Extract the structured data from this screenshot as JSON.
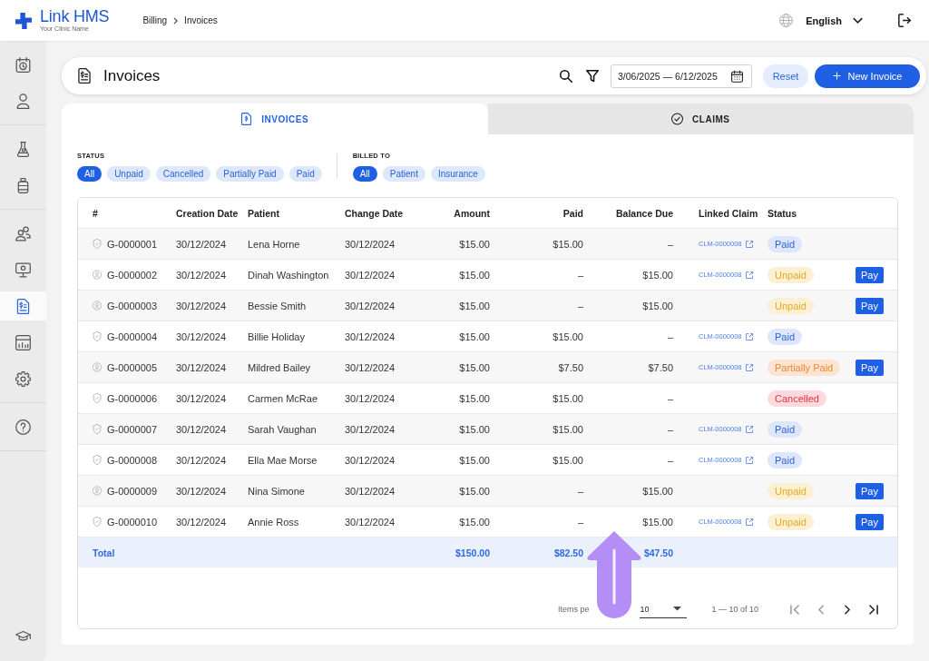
{
  "top_bar": {
    "app_name": "Link HMS",
    "clinic_name": "Your Clinic Name",
    "breadcrumb": [
      "Billing",
      "Invoices"
    ],
    "language": "English"
  },
  "sidebar": {
    "groups": [
      {
        "items": [
          {
            "kind": "calendar",
            "selected": false
          },
          {
            "kind": "person",
            "selected": false
          }
        ]
      },
      {
        "items": [
          {
            "kind": "flask",
            "selected": false
          },
          {
            "kind": "bottle",
            "selected": false
          }
        ]
      },
      {
        "items": [
          {
            "kind": "people",
            "selected": false
          },
          {
            "kind": "monitor",
            "selected": false
          },
          {
            "kind": "invoice",
            "selected": true
          },
          {
            "kind": "chart",
            "selected": false
          },
          {
            "kind": "gear",
            "selected": false
          }
        ]
      },
      {
        "items": [
          {
            "kind": "help",
            "selected": false
          }
        ]
      }
    ],
    "bottom_items": [
      {
        "kind": "cap",
        "selected": false
      }
    ]
  },
  "page_header": {
    "title": "Invoices",
    "date_range": "3/06/2025 — 6/12/2025",
    "buttons": [
      {
        "label": "Reset",
        "kind": "secondary"
      },
      {
        "label": "New Invoice",
        "kind": "primary"
      }
    ]
  },
  "tabs": [
    {
      "label": "INVOICES",
      "kind": "invoice",
      "selected": true
    },
    {
      "label": "CLAIMS",
      "kind": "check",
      "selected": false
    }
  ],
  "filters": [
    {
      "label": "STATUS",
      "chips": [
        {
          "label": "All",
          "selected": true
        },
        {
          "label": "Unpaid",
          "selected": false
        },
        {
          "label": "Cancelled",
          "selected": false
        },
        {
          "label": "Partially Paid",
          "selected": false
        },
        {
          "label": "Paid",
          "selected": false
        }
      ]
    },
    {
      "label": "BILLED TO",
      "chips": [
        {
          "label": "All",
          "selected": true
        },
        {
          "label": "Patient",
          "selected": false
        },
        {
          "label": "Insurance",
          "selected": false
        }
      ]
    }
  ],
  "table": {
    "columns": [
      "#",
      "Creation Date",
      "Patient",
      "Change Date",
      "Amount",
      "Paid",
      "Balance Due",
      "Linked Claim",
      "Status"
    ],
    "rows": [
      {
        "kind": "insurance",
        "number": "G-0000001",
        "creation_date": "30/12/2024",
        "patient": "Lena Horne",
        "change_date": "30/12/2024",
        "amount": "$15.00",
        "paid": "$15.00",
        "balance_due": "–",
        "linked_claim": "CLM-0000008",
        "status": {
          "label": "Paid",
          "kind": "paid"
        }
      },
      {
        "kind": "patient",
        "number": "G-0000002",
        "creation_date": "30/12/2024",
        "patient": "Dinah Washington",
        "change_date": "30/12/2024",
        "amount": "$15.00",
        "paid": "–",
        "balance_due": "$15.00",
        "linked_claim": "CLM-0000008",
        "status": {
          "label": "Unpaid",
          "kind": "unpaid"
        },
        "action": "Pay"
      },
      {
        "kind": "patient",
        "number": "G-0000003",
        "creation_date": "30/12/2024",
        "patient": "Bessie Smith",
        "change_date": "30/12/2024",
        "amount": "$15.00",
        "paid": "–",
        "balance_due": "$15.00",
        "status": {
          "label": "Unpaid",
          "kind": "unpaid"
        },
        "action": "Pay"
      },
      {
        "kind": "insurance",
        "number": "G-0000004",
        "creation_date": "30/12/2024",
        "patient": "Billie Holiday",
        "change_date": "30/12/2024",
        "amount": "$15.00",
        "paid": "$15.00",
        "balance_due": "–",
        "linked_claim": "CLM-0000008",
        "status": {
          "label": "Paid",
          "kind": "paid"
        }
      },
      {
        "kind": "patient",
        "number": "G-0000005",
        "creation_date": "30/12/2024",
        "patient": "Mildred Bailey",
        "change_date": "30/12/2024",
        "amount": "$15.00",
        "paid": "$7.50",
        "balance_due": "$7.50",
        "linked_claim": "CLM-0000008",
        "status": {
          "label": "Partially Paid",
          "kind": "partial"
        },
        "action": "Pay"
      },
      {
        "kind": "insurance",
        "number": "G-0000006",
        "creation_date": "30/12/2024",
        "patient": "Carmen McRae",
        "change_date": "30/12/2024",
        "amount": "$15.00",
        "paid": "$15.00",
        "balance_due": "–",
        "status": {
          "label": "Cancelled",
          "kind": "cancelled"
        }
      },
      {
        "kind": "insurance",
        "number": "G-0000007",
        "creation_date": "30/12/2024",
        "patient": "Sarah Vaughan",
        "change_date": "30/12/2024",
        "amount": "$15.00",
        "paid": "$15.00",
        "balance_due": "–",
        "linked_claim": "CLM-0000008",
        "status": {
          "label": "Paid",
          "kind": "paid"
        }
      },
      {
        "kind": "insurance",
        "number": "G-0000008",
        "creation_date": "30/12/2024",
        "patient": "Ella Mae Morse",
        "change_date": "30/12/2024",
        "amount": "$15.00",
        "paid": "$15.00",
        "balance_due": "–",
        "linked_claim": "CLM-0000008",
        "status": {
          "label": "Paid",
          "kind": "paid"
        }
      },
      {
        "kind": "patient",
        "number": "G-0000009",
        "creation_date": "30/12/2024",
        "patient": "Nina Simone",
        "change_date": "30/12/2024",
        "amount": "$15.00",
        "paid": "–",
        "balance_due": "$15.00",
        "status": {
          "label": "Unpaid",
          "kind": "unpaid"
        },
        "action": "Pay"
      },
      {
        "kind": "insurance",
        "number": "G-0000010",
        "creation_date": "30/12/2024",
        "patient": "Annie Ross",
        "change_date": "30/12/2024",
        "amount": "$15.00",
        "paid": "–",
        "balance_due": "$15.00",
        "linked_claim": "CLM-0000008",
        "status": {
          "label": "Unpaid",
          "kind": "unpaid"
        },
        "action": "Pay"
      }
    ],
    "total": {
      "label": "Total",
      "amount": "$150.00",
      "paid": "$82.50",
      "balance_due": "$47.50"
    }
  },
  "pagination": {
    "items_per_page_label": "Items pe",
    "page_size": "10",
    "range": "1 — 10 of 10",
    "buttons": [
      {
        "kind": "first",
        "disabled": true
      },
      {
        "kind": "prev",
        "disabled": true
      },
      {
        "kind": "next",
        "disabled": false
      },
      {
        "kind": "last",
        "disabled": false
      }
    ]
  },
  "annotation": {
    "kind": "up-arrow"
  }
}
